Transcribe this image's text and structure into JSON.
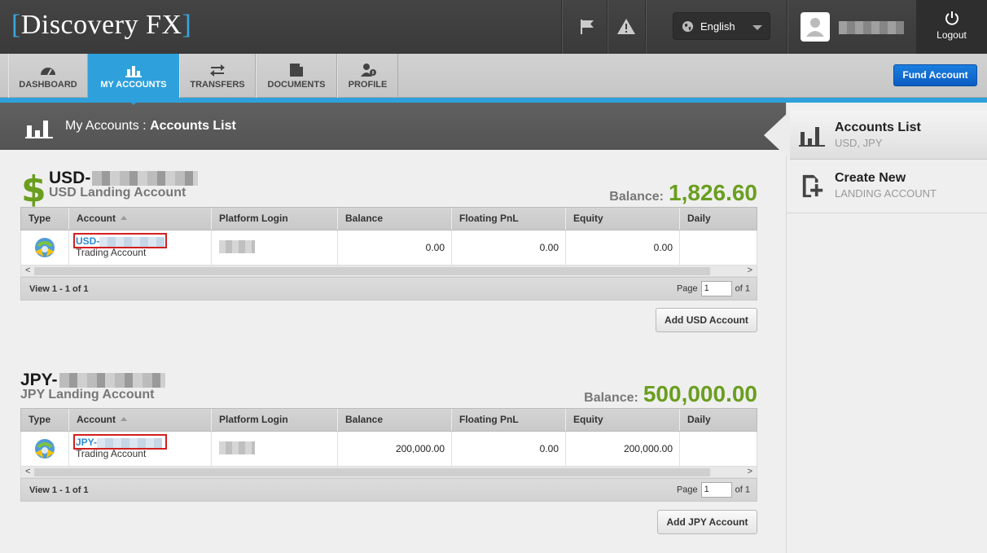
{
  "header": {
    "logo_text": "Discovery FX",
    "logo_bracket_left": "[",
    "logo_bracket_right": "]",
    "language": "English",
    "logout_label": "Logout"
  },
  "nav": {
    "items": [
      {
        "label": "DASHBOARD",
        "icon": "gauge-icon"
      },
      {
        "label": "MY ACCOUNTS",
        "icon": "bar-chart-icon",
        "active": true
      },
      {
        "label": "TRANSFERS",
        "icon": "transfer-arrows-icon"
      },
      {
        "label": "DOCUMENTS",
        "icon": "document-icon"
      },
      {
        "label": "PROFILE",
        "icon": "profile-icon"
      }
    ],
    "fund_button": "Fund Account"
  },
  "titlebar": {
    "section": "My Accounts",
    "separator": ":",
    "page": "Accounts List"
  },
  "sidebar": {
    "accounts_list": {
      "title": "Accounts List",
      "subtitle": "USD, JPY"
    },
    "create_new": {
      "title": "Create New",
      "subtitle": "LANDING ACCOUNT"
    }
  },
  "columns": [
    "Type",
    "Account",
    "Platform Login",
    "Balance",
    "Floating PnL",
    "Equity",
    "Daily"
  ],
  "accounts": [
    {
      "currency_symbol": "$",
      "title_prefix": "USD-",
      "subtitle": "USD Landing Account",
      "balance_label": "Balance:",
      "balance_value": "1,826.60",
      "row": {
        "account_prefix": "USD-",
        "account_type": "Trading Account",
        "balance": "0.00",
        "floating_pnl": "0.00",
        "equity": "0.00",
        "daily": ""
      },
      "view_text": "View 1 - 1 of 1",
      "page_label": "Page",
      "page_value": "1",
      "page_of": "of 1",
      "add_button": "Add USD Account"
    },
    {
      "currency_symbol": "",
      "title_prefix": "JPY-",
      "subtitle": "JPY Landing Account",
      "balance_label": "Balance:",
      "balance_value": "500,000.00",
      "row": {
        "account_prefix": "JPY-",
        "account_type": "Trading Account",
        "balance": "200,000.00",
        "floating_pnl": "0.00",
        "equity": "200,000.00",
        "daily": ""
      },
      "view_text": "View 1 - 1 of 1",
      "page_label": "Page",
      "page_value": "1",
      "page_of": "of 1",
      "add_button": "Add JPY Account"
    }
  ],
  "scroll_arrows": {
    "left": "<",
    "right": ">"
  },
  "colors": {
    "accent_blue": "#2ea0dc",
    "balance_green": "#6a9e1f",
    "header_dark": "#3a3a3a",
    "highlight_red": "#d21f1f"
  }
}
